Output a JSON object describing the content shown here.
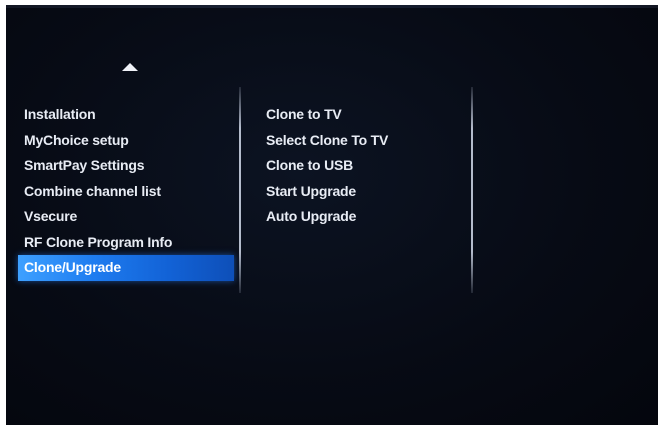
{
  "menu": {
    "left_items": [
      {
        "label": "Installation"
      },
      {
        "label": "MyChoice setup"
      },
      {
        "label": "SmartPay Settings"
      },
      {
        "label": "Combine channel list"
      },
      {
        "label": "Vsecure"
      },
      {
        "label": "RF Clone Program Info"
      },
      {
        "label": "Clone/Upgrade",
        "selected": true
      }
    ],
    "right_items": [
      {
        "label": "Clone to TV"
      },
      {
        "label": "Select Clone To TV"
      },
      {
        "label": "Clone to USB"
      },
      {
        "label": "Start Upgrade"
      },
      {
        "label": "Auto Upgrade"
      }
    ]
  },
  "colors": {
    "background": "#070b15",
    "text": "#e8ecf4",
    "highlight": "#1e7cf0"
  },
  "icons": {
    "scroll_up": "up-arrow-icon"
  }
}
